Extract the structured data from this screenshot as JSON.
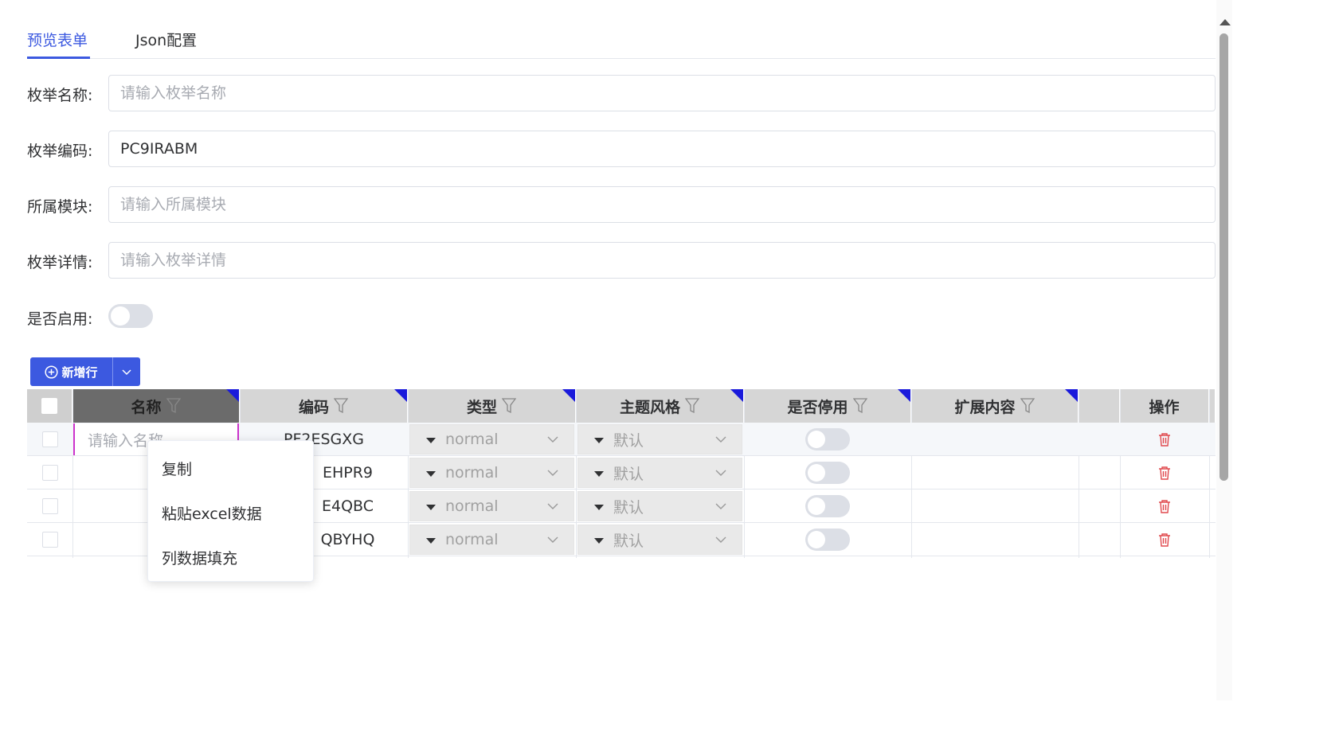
{
  "tabs": [
    {
      "label": "预览表单",
      "active": true
    },
    {
      "label": "Json配置",
      "active": false
    }
  ],
  "form": {
    "enum_name": {
      "label": "枚举名称:",
      "placeholder": "请输入枚举名称",
      "value": ""
    },
    "enum_code": {
      "label": "枚举编码:",
      "placeholder": "",
      "value": "PC9IRABM"
    },
    "module": {
      "label": "所属模块:",
      "placeholder": "请输入所属模块",
      "value": ""
    },
    "detail": {
      "label": "枚举详情:",
      "placeholder": "请输入枚举详情",
      "value": ""
    },
    "enabled": {
      "label": "是否启用:",
      "on": false
    }
  },
  "toolbar": {
    "add_row_label": "新增行"
  },
  "table": {
    "columns": [
      "名称",
      "编码",
      "类型",
      "主题风格",
      "是否停用",
      "扩展内容",
      "操作"
    ],
    "name_placeholder": "请输入名称",
    "rows": [
      {
        "code": "PF2ESGXG",
        "type": "normal",
        "theme": "默认",
        "disabled": false,
        "ext": ""
      },
      {
        "code": "EHPR9",
        "type": "normal",
        "theme": "默认",
        "disabled": false,
        "ext": ""
      },
      {
        "code": "E4QBC",
        "type": "normal",
        "theme": "默认",
        "disabled": false,
        "ext": ""
      },
      {
        "code": "QBYHQ",
        "type": "normal",
        "theme": "默认",
        "disabled": false,
        "ext": ""
      }
    ]
  },
  "context_menu": {
    "items": [
      "复制",
      "粘贴excel数据",
      "列数据填充"
    ]
  },
  "colors": {
    "accent": "#3c59e0",
    "header_bg": "#d6d6d6",
    "corner_mark": "#1a1adb",
    "delete": "#e0484d",
    "active_cell_border": "#cc33cc"
  }
}
